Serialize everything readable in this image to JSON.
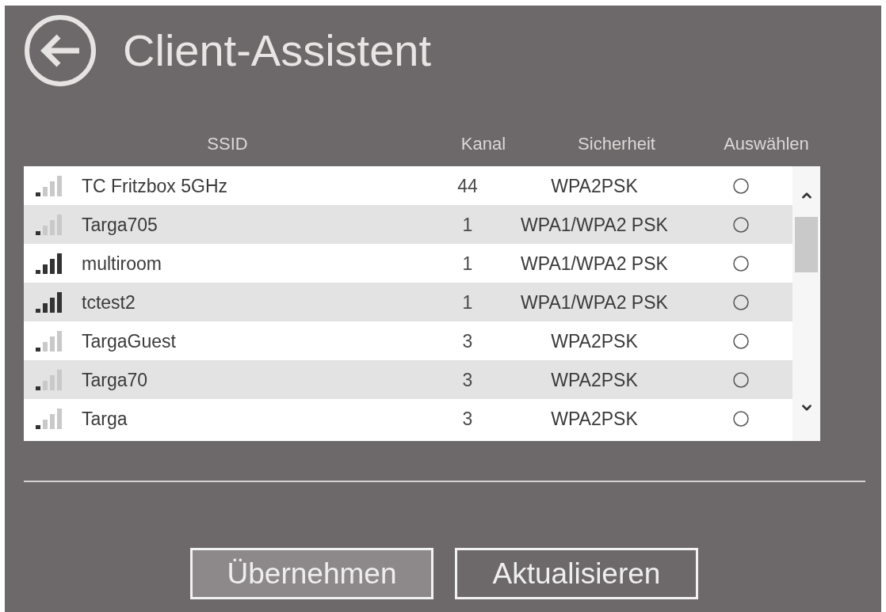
{
  "header": {
    "title": "Client-Assistent"
  },
  "table": {
    "columns": [
      "SSID",
      "Kanal",
      "Sicherheit",
      "Auswählen"
    ],
    "rows": [
      {
        "strong_signal": false,
        "ssid": "TC Fritzbox 5GHz",
        "kanal": "44",
        "sicherheit": "WPA2PSK",
        "selected": false
      },
      {
        "strong_signal": false,
        "ssid": "Targa705",
        "kanal": "1",
        "sicherheit": "WPA1/WPA2 PSK",
        "selected": false
      },
      {
        "strong_signal": true,
        "ssid": "multiroom",
        "kanal": "1",
        "sicherheit": "WPA1/WPA2 PSK",
        "selected": false
      },
      {
        "strong_signal": true,
        "ssid": "tctest2",
        "kanal": "1",
        "sicherheit": "WPA1/WPA2 PSK",
        "selected": false
      },
      {
        "strong_signal": false,
        "ssid": "TargaGuest",
        "kanal": "3",
        "sicherheit": "WPA2PSK",
        "selected": false
      },
      {
        "strong_signal": false,
        "ssid": "Targa70",
        "kanal": "3",
        "sicherheit": "WPA2PSK",
        "selected": false
      },
      {
        "strong_signal": false,
        "ssid": "Targa",
        "kanal": "3",
        "sicherheit": "WPA2PSK",
        "selected": false
      }
    ]
  },
  "buttons": [
    {
      "label": "Übernehmen",
      "highlighted": true
    },
    {
      "label": "Aktualisieren",
      "highlighted": false
    }
  ]
}
